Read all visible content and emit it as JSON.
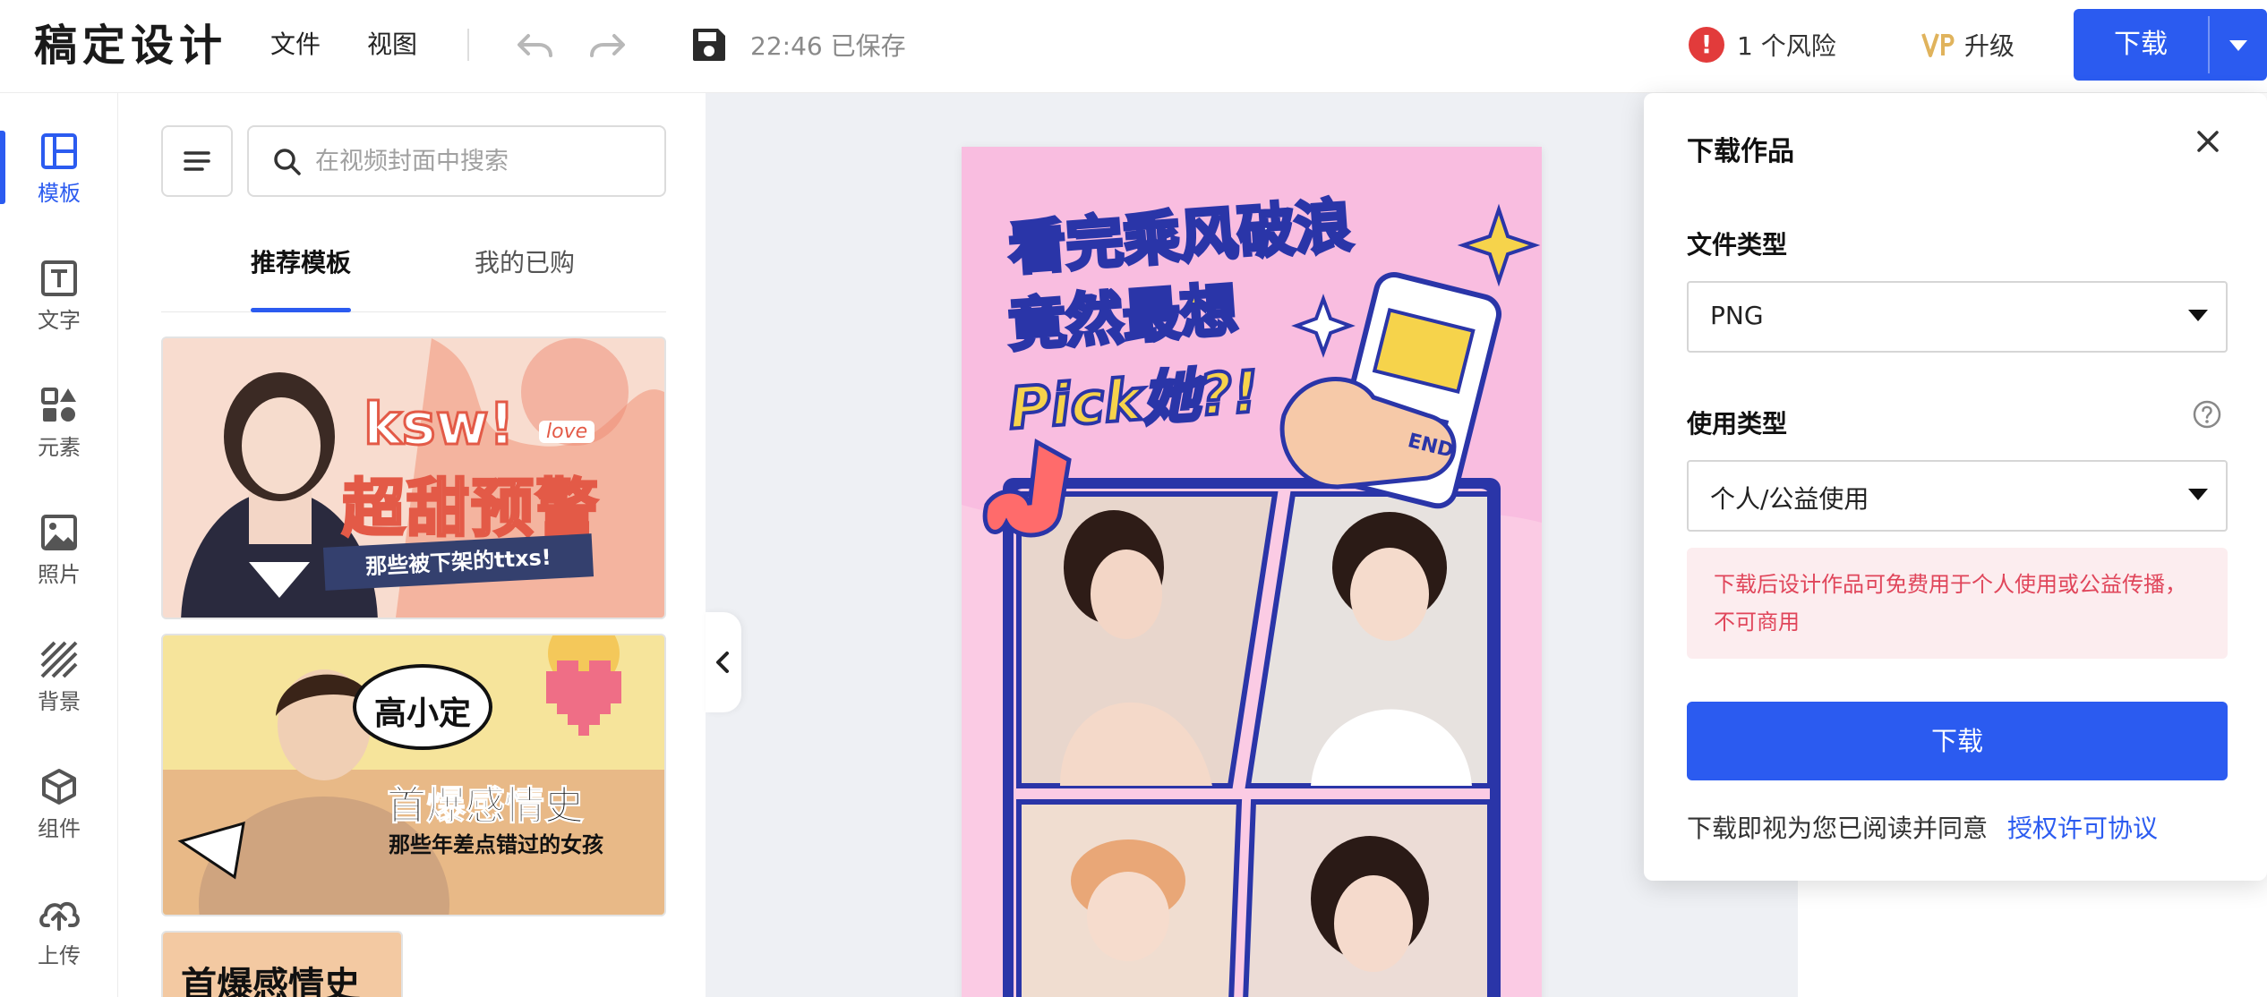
{
  "header": {
    "logo": "稿定设计",
    "menu": [
      "文件",
      "视图"
    ],
    "save_status": "22:46 已保存",
    "risk": "1 个风险",
    "upgrade": "升级",
    "download": "下载",
    "colors": {
      "accent": "#2b5bf0",
      "risk": "#e23b3b"
    }
  },
  "rail": [
    {
      "label": "模板",
      "icon": "template-icon",
      "active": true
    },
    {
      "label": "文字",
      "icon": "text-icon"
    },
    {
      "label": "元素",
      "icon": "elements-icon"
    },
    {
      "label": "照片",
      "icon": "photo-icon"
    },
    {
      "label": "背景",
      "icon": "background-icon"
    },
    {
      "label": "组件",
      "icon": "component-icon"
    },
    {
      "label": "上传",
      "icon": "upload-icon"
    }
  ],
  "panel": {
    "search_placeholder": "在视频封面中搜索",
    "tabs": [
      "推荐模板",
      "我的已购"
    ],
    "templates": [
      {
        "title": "超甜预警",
        "badge": "ksw!",
        "sticker": "love",
        "subtitle": "那些被下架的ttxs!"
      },
      {
        "title": "首爆感情史",
        "bubble": "高小定",
        "subtitle": "那些年差点错过的女孩"
      },
      {
        "title": "首爆感情史"
      }
    ]
  },
  "poster": {
    "lines": [
      "看完乘风破浪",
      "竟然",
      "最想",
      "Pick她?!"
    ],
    "phone_tag": "END"
  },
  "popover": {
    "title": "下载作品",
    "file_type_label": "文件类型",
    "file_type_value": "PNG",
    "usage_label": "使用类型",
    "usage_value": "个人/公益使用",
    "notice": "下载后设计作品可免费用于个人使用或公益传播，不可商用",
    "download_button": "下载",
    "agree_text": "下载即视为您已阅读并同意",
    "agree_link": "授权许可协议"
  }
}
